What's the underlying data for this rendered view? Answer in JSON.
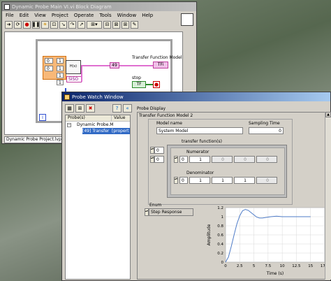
{
  "block_diagram": {
    "title": "Dynamic Probe Main VI.vi Block Diagram",
    "menus": [
      "File",
      "Edit",
      "View",
      "Project",
      "Operate",
      "Tools",
      "Window",
      "Help"
    ],
    "transfer_label": "Transfer Function Model",
    "stop_label": "stop",
    "probe_number": "49",
    "tf_indicator": "TFi",
    "siso": "SISO",
    "const_values": [
      "0",
      "0",
      "1",
      "1",
      "1",
      "1"
    ],
    "tf_bool": "TF",
    "status_text": "Dynamic Probe Project.lvproj/"
  },
  "probe_window": {
    "title": "Probe Watch Window",
    "col_probes": "Probe(s)",
    "col_value": "Value",
    "tree_parent": "Dynamic Probe.M",
    "tree_child_probe": "[49] Transfer",
    "tree_child_value": "[propert",
    "display_label": "Probe Display",
    "tf_model_label": "Transfer Function Model 2",
    "model_name_label": "Model name",
    "model_name_value": "System Model",
    "sampling_label": "Sampling Time",
    "sampling_value": "0",
    "tfs_label": "transfer function(s)",
    "index1": "0",
    "index2": "0",
    "numerator_label": "Numerator",
    "numerator_index": "0",
    "numerator_values": [
      "1",
      "0",
      "0",
      "0"
    ],
    "denominator_label": "Denominator",
    "denominator_index": "0",
    "denominator_values": [
      "1",
      "1",
      "1",
      "0"
    ],
    "enum_label": "Enum",
    "enum_value": "Step Response"
  },
  "chart_data": {
    "type": "line",
    "title": "",
    "xlabel": "Time (s)",
    "ylabel": "Amplitude",
    "xlim": [
      0,
      17.5
    ],
    "ylim": [
      0,
      1.2
    ],
    "x_ticks": [
      "0",
      "2.5",
      "5",
      "7.5",
      "10",
      "12.5",
      "15",
      "17.5"
    ],
    "y_ticks": [
      "0",
      "0.2",
      "0.4",
      "0.6",
      "0.8",
      "1",
      "1.2"
    ],
    "grid": true,
    "series": [
      {
        "x": [
          0,
          0.5,
          1,
          1.5,
          2,
          2.5,
          3,
          3.5,
          4,
          4.5,
          5,
          5.5,
          6,
          6.5,
          7,
          7.5,
          8,
          9,
          10,
          11,
          12,
          13,
          14,
          15
        ],
        "values": [
          0,
          0.11,
          0.34,
          0.6,
          0.84,
          1.02,
          1.13,
          1.16,
          1.14,
          1.09,
          1.04,
          0.99,
          0.97,
          0.97,
          0.98,
          0.99,
          1.0,
          1.01,
          1.0,
          1.0,
          1.0,
          1.0,
          1.0,
          1.0
        ]
      }
    ],
    "line_color": "#4f7cc8"
  }
}
